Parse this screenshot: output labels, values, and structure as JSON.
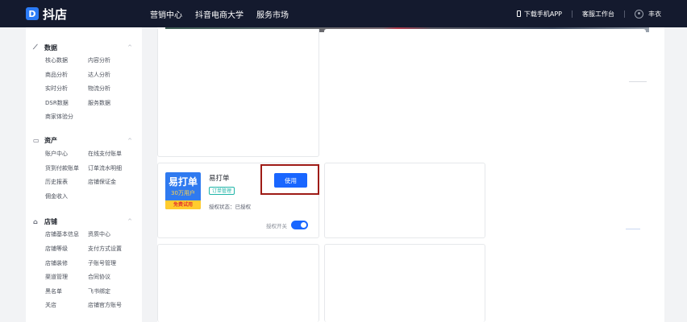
{
  "header": {
    "logo_mark": "D",
    "brand": "抖店",
    "nav": [
      "营销中心",
      "抖音电商大学",
      "服务市场"
    ],
    "download_app": "下载手机APP",
    "workbench": "客服工作台",
    "user": "丰衣"
  },
  "sidebar": {
    "groups": [
      {
        "title": "数据",
        "icon": "chart-icon",
        "items": [
          "核心数据",
          "内容分析",
          "商品分析",
          "达人分析",
          "实时分析",
          "物流分析",
          "DSR数据",
          "服务数据",
          "商家体验分"
        ]
      },
      {
        "title": "资产",
        "icon": "wallet-icon",
        "items": [
          "账户中心",
          "在线支付账单",
          "货到付款账单",
          "订单流水明细",
          "历史报表",
          "店铺保证金",
          "佣金收入"
        ]
      },
      {
        "title": "店铺",
        "icon": "store-icon",
        "items": [
          "店铺基本信息",
          "资质中心",
          "店铺等级",
          "支付方式设置",
          "店铺装修",
          "子账号管理",
          "渠道管理",
          "合同协议",
          "黑名单",
          "飞书绑定",
          "关店",
          "店铺官方账号"
        ]
      }
    ]
  },
  "app_card": {
    "logo_title": "易打单",
    "logo_sub": "30万用户",
    "logo_badge": "免费试用",
    "name": "易打单",
    "tag": "订单管理",
    "status": "授权状态：已授权",
    "use_button": "使用",
    "switch_label": "授权开关",
    "switch_on": true
  },
  "colors": {
    "topbar": "#141a2e",
    "primary": "#1966ff",
    "highlight_box": "#9e1b16",
    "tag": "#1fb5a8"
  }
}
